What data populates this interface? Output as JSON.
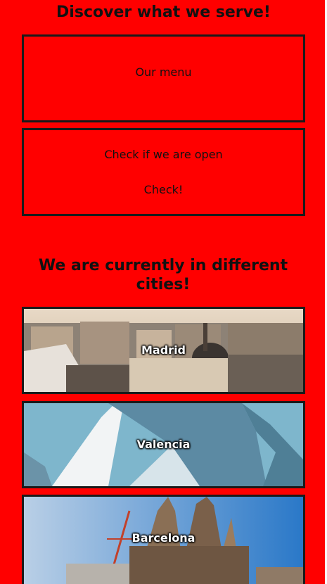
{
  "serve_section": {
    "title": "Discover what we serve!",
    "menu_label": "Our menu",
    "open_prompt": "Check if we are open",
    "check_label": "Check!"
  },
  "cities_section": {
    "title": "We are currently in different cities!",
    "cities": [
      {
        "name": "Madrid"
      },
      {
        "name": "Valencia"
      },
      {
        "name": "Barcelona"
      }
    ]
  },
  "colors": {
    "page_background": "#ff0000",
    "border": "#1a1a1a",
    "text": "#111111",
    "city_label": "#ffffff"
  }
}
